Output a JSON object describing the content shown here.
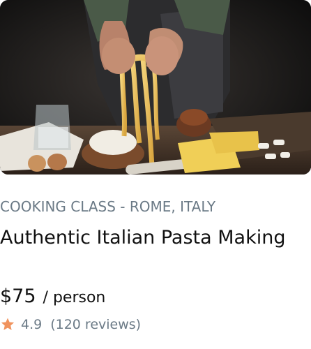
{
  "card": {
    "image_alt": "Hands holding fresh pasta over a rustic kitchen table",
    "category": "COOKING CLASS - ROME, ITALY",
    "title": "Authentic Italian Pasta Making",
    "price": "$75",
    "price_unit": "/ person",
    "rating": "4.9",
    "reviews": "(120 reviews)",
    "star_icon": "star-icon",
    "star_color": "#f0935e",
    "muted_color": "#6b7a86"
  }
}
